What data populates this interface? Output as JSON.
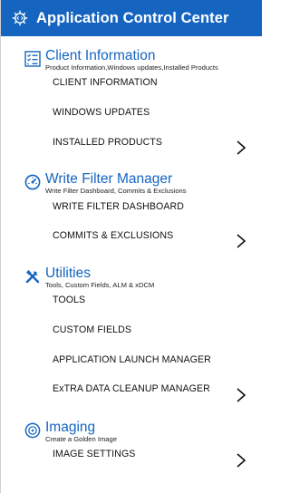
{
  "app": {
    "title": "Application Control Center",
    "icon": "gear-code-icon",
    "header_color": "#1565c0",
    "accent_color": "#1565c0"
  },
  "sections": [
    {
      "title": "Client Information",
      "subtitle": "Product Information,Windows updates,Installed Products",
      "icon": "checklist-icon",
      "items": [
        {
          "label": "CLIENT INFORMATION"
        },
        {
          "label": "WINDOWS UPDATES"
        },
        {
          "label": "INSTALLED PRODUCTS"
        }
      ],
      "expand_icon": "chevron-right-icon"
    },
    {
      "title": "Write Filter Manager",
      "subtitle": "Write Filter Dashboard, Commits & Exclusions",
      "icon": "gauge-icon",
      "items": [
        {
          "label": "WRITE FILTER DASHBOARD"
        },
        {
          "label": "COMMITS & EXCLUSIONS"
        }
      ],
      "expand_icon": "chevron-right-icon"
    },
    {
      "title": "Utilities",
      "subtitle": "Tools, Custom Fields, ALM & xDCM",
      "icon": "tools-icon",
      "items": [
        {
          "label": "TOOLS"
        },
        {
          "label": "CUSTOM FIELDS"
        },
        {
          "label": "APPLICATION LAUNCH MANAGER"
        },
        {
          "label": "ExTRA DATA CLEANUP MANAGER"
        }
      ],
      "expand_icon": "chevron-right-icon"
    },
    {
      "title": "Imaging",
      "subtitle": "Create a Golden Image",
      "icon": "disc-icon",
      "items": [
        {
          "label": "IMAGE SETTINGS"
        }
      ],
      "expand_icon": "chevron-right-icon"
    }
  ]
}
